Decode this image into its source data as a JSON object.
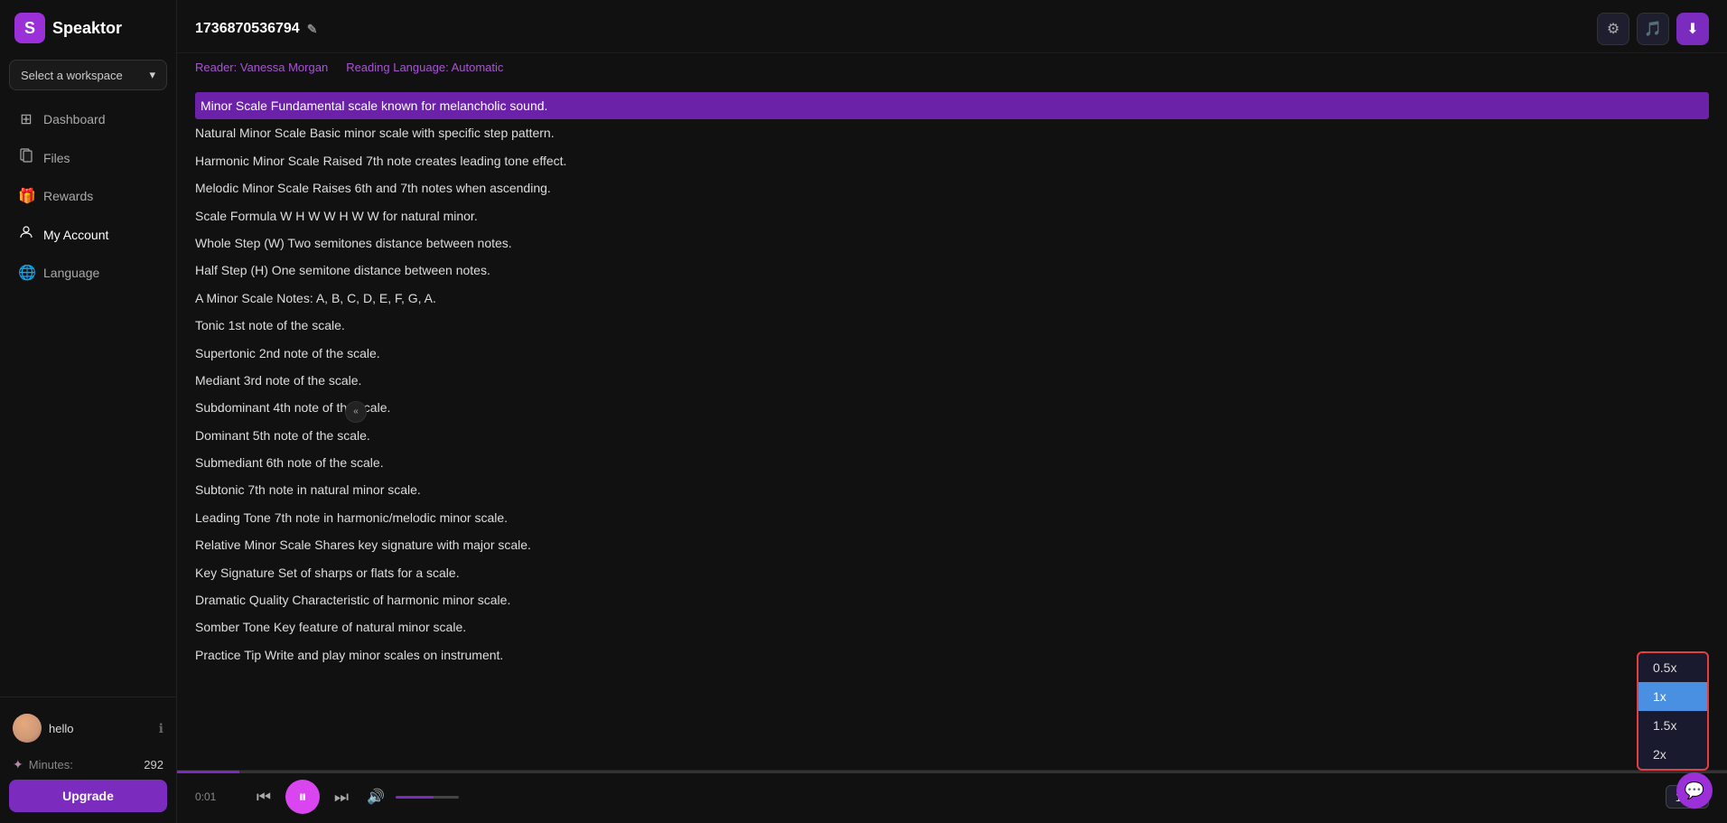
{
  "app": {
    "name": "Speaktor",
    "logo_letter": "S"
  },
  "workspace": {
    "label": "Select a workspace",
    "chevron": "▾"
  },
  "nav": {
    "items": [
      {
        "id": "dashboard",
        "label": "Dashboard",
        "icon": "⊞"
      },
      {
        "id": "files",
        "label": "Files",
        "icon": "📄"
      },
      {
        "id": "rewards",
        "label": "Rewards",
        "icon": "🎁"
      },
      {
        "id": "my-account",
        "label": "My Account",
        "icon": "👤"
      },
      {
        "id": "language",
        "label": "Language",
        "icon": "🌐"
      }
    ]
  },
  "user": {
    "name": "hello",
    "minutes_label": "Minutes:",
    "minutes_value": "292",
    "upgrade_label": "Upgrade"
  },
  "document": {
    "id": "1736870536794",
    "reader_label": "Reader: Vanessa Morgan",
    "language_label": "Reading Language: Automatic"
  },
  "header_buttons": {
    "settings": "⚙",
    "audio": "🎵",
    "download": "⬇"
  },
  "content": {
    "lines": [
      {
        "text": "Minor Scale  Fundamental scale known for melancholic sound.",
        "highlighted": true
      },
      {
        "text": "Natural Minor Scale    Basic minor scale with specific step pattern.",
        "highlighted": false
      },
      {
        "text": "Harmonic Minor Scale    Raised 7th note creates leading tone effect.",
        "highlighted": false
      },
      {
        "text": "Melodic Minor Scale    Raises 6th and 7th notes when ascending.",
        "highlighted": false
      },
      {
        "text": "Scale Formula  W H W W H W W for natural minor.",
        "highlighted": false
      },
      {
        "text": "Whole Step (W)    Two semitones distance between notes.",
        "highlighted": false
      },
      {
        "text": "Half Step (H)    One semitone distance between notes.",
        "highlighted": false
      },
      {
        "text": "A Minor Scale    Notes: A, B, C, D, E, F, G, A.",
        "highlighted": false
      },
      {
        "text": "Tonic  1st note of the scale.",
        "highlighted": false
      },
      {
        "text": "Supertonic    2nd note of the scale.",
        "highlighted": false
      },
      {
        "text": "Mediant  3rd note of the scale.",
        "highlighted": false
      },
      {
        "text": "Subdominant    4th note of the scale.",
        "highlighted": false
      },
      {
        "text": "Dominant  5th note of the scale.",
        "highlighted": false
      },
      {
        "text": "Submediant  6th note of the scale.",
        "highlighted": false
      },
      {
        "text": "Subtonic    7th note in natural minor scale.",
        "highlighted": false
      },
      {
        "text": "Leading Tone  7th note in harmonic/melodic minor scale.",
        "highlighted": false
      },
      {
        "text": "Relative Minor Scale  Shares key signature with major scale.",
        "highlighted": false
      },
      {
        "text": "Key Signature  Set of sharps or flats for a scale.",
        "highlighted": false
      },
      {
        "text": "Dramatic Quality  Characteristic of harmonic minor scale.",
        "highlighted": false
      },
      {
        "text": "Somber Tone    Key feature of natural minor scale.",
        "highlighted": false
      },
      {
        "text": "Practice Tip  Write and play minor scales on instrument.",
        "highlighted": false
      }
    ]
  },
  "player": {
    "time": "0:01",
    "prev_icon": "⏮",
    "play_pause_icon": "⏸",
    "next_icon": "⏭",
    "volume_icon": "🔊",
    "speed_current": "1x"
  },
  "speed_options": [
    {
      "value": "0.5x",
      "selected": false
    },
    {
      "value": "1x",
      "selected": true
    },
    {
      "value": "1.5x",
      "selected": false
    },
    {
      "value": "2x",
      "selected": false
    }
  ],
  "chat": {
    "icon": "💬"
  },
  "collapse_btn": "«"
}
